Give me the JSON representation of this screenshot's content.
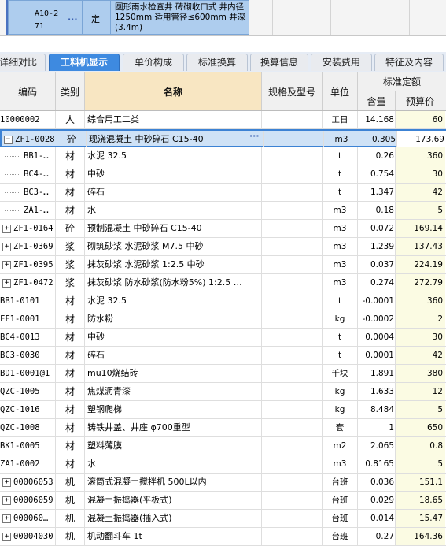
{
  "top_row": {
    "code": "A10-2\n71",
    "type": "定",
    "name": "圆形雨水检查井 砖砌收口式 井内径1250mm 适用管径≤600mm 井深(3.4m)"
  },
  "tabs": [
    {
      "label": "详细对比",
      "active": false
    },
    {
      "label": "工料机显示",
      "active": true
    },
    {
      "label": "单价构成",
      "active": false
    },
    {
      "label": "标准换算",
      "active": false
    },
    {
      "label": "换算信息",
      "active": false
    },
    {
      "label": "安装费用",
      "active": false
    },
    {
      "label": "特征及内容",
      "active": false
    }
  ],
  "header": {
    "code": "编码",
    "category": "类别",
    "name": "名称",
    "spec": "规格及型号",
    "unit": "单位",
    "quota_group": "标准定额",
    "qty": "含量",
    "price": "预算价"
  },
  "rows": [
    {
      "code": "10000002",
      "expander": "",
      "cat": "人",
      "name": "综合用工二类",
      "unit": "工日",
      "qty": "14.168",
      "price": "60"
    },
    {
      "code": "ZF1-0028",
      "expander": "−",
      "cat": "砼",
      "name": "现浇混凝土 中砂碎石 C15-40",
      "unit": "m3",
      "qty": "0.305",
      "price": "173.69",
      "selected": true
    },
    {
      "code": "BB1-…",
      "tree": true,
      "cat": "材",
      "name": "水泥 32.5",
      "unit": "t",
      "qty": "0.26",
      "price": "360"
    },
    {
      "code": "BC4-…",
      "tree": true,
      "cat": "材",
      "name": "中砂",
      "unit": "t",
      "qty": "0.754",
      "price": "30"
    },
    {
      "code": "BC3-…",
      "tree": true,
      "cat": "材",
      "name": "碎石",
      "unit": "t",
      "qty": "1.347",
      "price": "42"
    },
    {
      "code": "ZA1-…",
      "tree": true,
      "cat": "材",
      "name": "水",
      "unit": "m3",
      "qty": "0.18",
      "price": "5"
    },
    {
      "code": "ZF1-0164",
      "expander": "+",
      "cat": "砼",
      "name": "预制混凝土 中砂碎石 C15-40",
      "unit": "m3",
      "qty": "0.072",
      "price": "169.14"
    },
    {
      "code": "ZF1-0369",
      "expander": "+",
      "cat": "浆",
      "name": "砌筑砂浆 水泥砂浆 M7.5 中砂",
      "unit": "m3",
      "qty": "1.239",
      "price": "137.43"
    },
    {
      "code": "ZF1-0395",
      "expander": "+",
      "cat": "浆",
      "name": "抹灰砂浆 水泥砂浆 1:2.5 中砂",
      "unit": "m3",
      "qty": "0.037",
      "price": "224.19"
    },
    {
      "code": "ZF1-0472",
      "expander": "+",
      "cat": "浆",
      "name": "抹灰砂浆 防水砂浆(防水粉5%) 1:2.5 …",
      "unit": "m3",
      "qty": "0.274",
      "price": "272.79"
    },
    {
      "code": "BB1-0101",
      "cat": "材",
      "name": "水泥 32.5",
      "unit": "t",
      "qty": "-0.0001",
      "price": "360"
    },
    {
      "code": "FF1-0001",
      "cat": "材",
      "name": "防水粉",
      "unit": "kg",
      "qty": "-0.0002",
      "price": "2"
    },
    {
      "code": "BC4-0013",
      "cat": "材",
      "name": "中砂",
      "unit": "t",
      "qty": "0.0004",
      "price": "30"
    },
    {
      "code": "BC3-0030",
      "cat": "材",
      "name": "碎石",
      "unit": "t",
      "qty": "0.0001",
      "price": "42"
    },
    {
      "code": "BD1-0001@1",
      "cat": "材",
      "name": "mu10烧结砖",
      "unit": "千块",
      "qty": "1.891",
      "price": "380"
    },
    {
      "code": "QZC-1005",
      "cat": "材",
      "name": "焦煤沥青漆",
      "unit": "kg",
      "qty": "1.633",
      "price": "12"
    },
    {
      "code": "QZC-1016",
      "cat": "材",
      "name": "塑钢爬梯",
      "unit": "kg",
      "qty": "8.484",
      "price": "5"
    },
    {
      "code": "QZC-1008",
      "cat": "材",
      "name": "铸铁井盖、井座 φ700重型",
      "unit": "套",
      "qty": "1",
      "price": "650"
    },
    {
      "code": "BK1-0005",
      "cat": "材",
      "name": "塑料薄膜",
      "unit": "m2",
      "qty": "2.065",
      "price": "0.8"
    },
    {
      "code": "ZA1-0002",
      "cat": "材",
      "name": "水",
      "unit": "m3",
      "qty": "0.8165",
      "price": "5"
    },
    {
      "code": "00006053",
      "expander": "+",
      "cat": "机",
      "name": "滚筒式混凝土搅拌机 500L以内",
      "unit": "台班",
      "qty": "0.036",
      "price": "151.1"
    },
    {
      "code": "00006059",
      "expander": "+",
      "cat": "机",
      "name": "混凝土振捣器(平板式)",
      "unit": "台班",
      "qty": "0.029",
      "price": "18.65"
    },
    {
      "code": "000060…",
      "expander": "+",
      "cat": "机",
      "name": "混凝土振捣器(插入式)",
      "unit": "台班",
      "qty": "0.014",
      "price": "15.47"
    },
    {
      "code": "00004030",
      "expander": "+",
      "cat": "机",
      "name": "机动翻斗车 1t",
      "unit": "台班",
      "qty": "0.27",
      "price": "164.36"
    }
  ]
}
